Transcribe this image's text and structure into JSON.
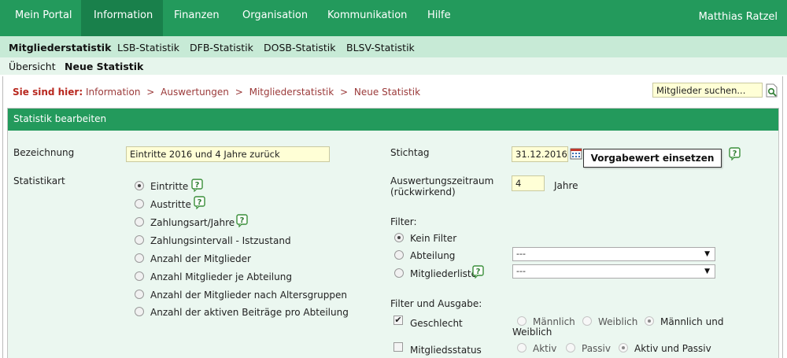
{
  "topnav": {
    "items": [
      {
        "label": "Mein Portal"
      },
      {
        "label": "Information",
        "active": true
      },
      {
        "label": "Finanzen"
      },
      {
        "label": "Organisation"
      },
      {
        "label": "Kommunikation"
      },
      {
        "label": "Hilfe"
      }
    ],
    "user": "Matthias Ratzel"
  },
  "subnav": {
    "items": [
      {
        "label": "Mitgliederstatistik",
        "active": true
      },
      {
        "label": "LSB-Statistik"
      },
      {
        "label": "DFB-Statistik"
      },
      {
        "label": "DOSB-Statistik"
      },
      {
        "label": "BLSV-Statistik"
      }
    ]
  },
  "subnav2": {
    "items": [
      {
        "label": "Übersicht"
      },
      {
        "label": "Neue Statistik",
        "active": true
      }
    ]
  },
  "breadcrumb": {
    "label": "Sie sind hier:",
    "path": [
      "Information",
      "Auswertungen",
      "Mitgliederstatistik",
      "Neue Statistik"
    ],
    "separator": ">"
  },
  "search": {
    "value": "Mitglieder suchen..."
  },
  "panel": {
    "title": "Statistik bearbeiten",
    "bezeichnung": {
      "label": "Bezeichnung",
      "value": "Eintritte 2016 und 4 Jahre zurück"
    },
    "statistikart": {
      "label": "Statistikart",
      "options": [
        {
          "label": "Eintritte",
          "checked": true,
          "help": true
        },
        {
          "label": "Austritte",
          "checked": false,
          "help": true
        },
        {
          "label": "Zahlungsart/Jahre",
          "checked": false,
          "help": true
        },
        {
          "label": "Zahlungsintervall - Istzustand",
          "checked": false,
          "help": false
        },
        {
          "label": "Anzahl der Mitglieder",
          "checked": false,
          "help": false
        },
        {
          "label": "Anzahl Mitglieder je Abteilung",
          "checked": false,
          "help": false
        },
        {
          "label": "Anzahl der Mitglieder nach Altersgruppen",
          "checked": false,
          "help": false
        },
        {
          "label": "Anzahl der aktiven Beiträge pro Abteilung",
          "checked": false,
          "help": false
        }
      ]
    },
    "stichtag": {
      "label": "Stichtag",
      "value": "31.12.2016",
      "button": "Vorgabewert einsetzen"
    },
    "zeitraum": {
      "label_line1": "Auswertungszeitraum",
      "label_line2": "(rückwirkend)",
      "value": "4",
      "unit": "Jahre"
    },
    "filter": {
      "label": "Filter:",
      "options": [
        {
          "label": "Kein Filter",
          "checked": true
        },
        {
          "label": "Abteilung",
          "checked": false,
          "select": "---"
        },
        {
          "label": "Mitgliederliste",
          "checked": false,
          "select": "---",
          "help": true
        }
      ]
    },
    "ausgabe": {
      "label": "Filter und Ausgabe:",
      "geschlecht": {
        "label": "Geschlecht",
        "checked": true,
        "options": [
          "Männlich",
          "Weiblich",
          "Männlich und"
        ],
        "wrap": "Weiblich",
        "selected_index": 2
      },
      "status": {
        "label": "Mitgliedsstatus",
        "checked": false,
        "options": [
          "Aktiv",
          "Passiv",
          "Aktiv und Passiv"
        ],
        "selected_index": 2
      }
    }
  },
  "colors": {
    "primary": "#239a5c",
    "primary_dark": "#19804b",
    "subnav": "#c7ead6",
    "panel_bg": "#ebf7f0",
    "input_bg": "#ffffd6",
    "breadcrumb": "#b8281f"
  }
}
